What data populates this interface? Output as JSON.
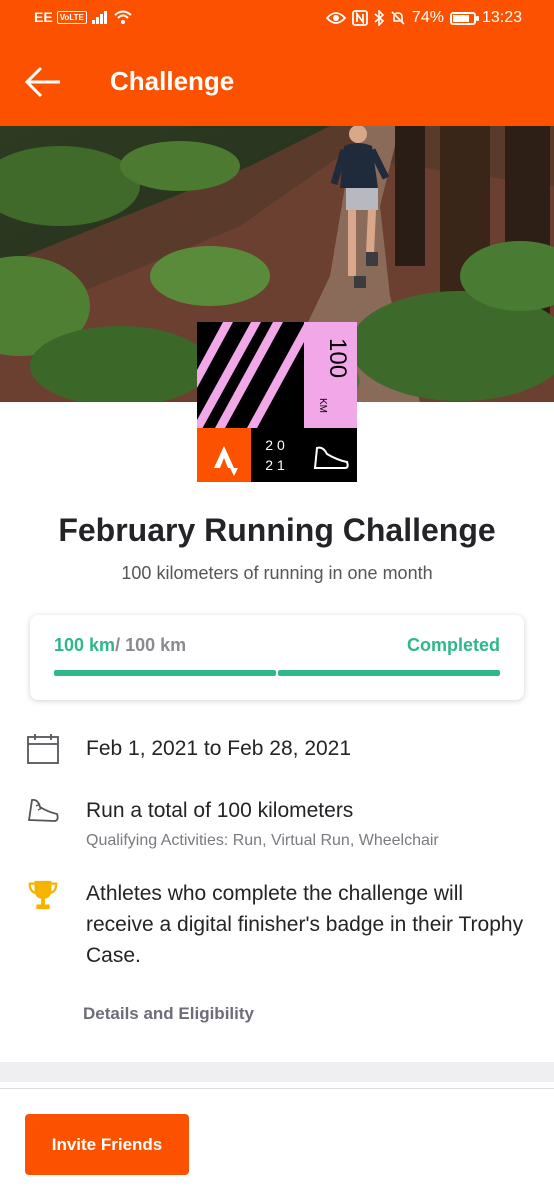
{
  "status_bar": {
    "carrier": "EE",
    "volte": "VoLTE",
    "battery": "74%",
    "time": "13:23"
  },
  "app_bar": {
    "title": "Challenge"
  },
  "badge": {
    "distance": "100",
    "unit": "KM",
    "year_top": "20",
    "year_bottom": "21",
    "colors": {
      "pink": "#f2a7e8",
      "orange": "#fc5200",
      "black": "#000000"
    }
  },
  "challenge": {
    "title": "February Running Challenge",
    "subtitle": "100 kilometers of running in one month"
  },
  "progress": {
    "current": "100 km",
    "goal": "/ 100 km",
    "status": "Completed",
    "fraction": 1.0,
    "color": "#2eb889"
  },
  "info": {
    "dates": "Feb 1, 2021 to Feb 28, 2021",
    "goal_text": "Run a total of 100 kilometers",
    "qualifying": "Qualifying Activities: Run, Virtual Run, Wheelchair",
    "reward": "Athletes who complete the challenge will receive a digital finisher's badge in their Trophy Case."
  },
  "links": {
    "details": "Details and Eligibility"
  },
  "footer": {
    "invite_label": "Invite Friends"
  },
  "colors": {
    "brand": "#fc5200",
    "success": "#2eb889",
    "trophy": "#f5b400"
  }
}
